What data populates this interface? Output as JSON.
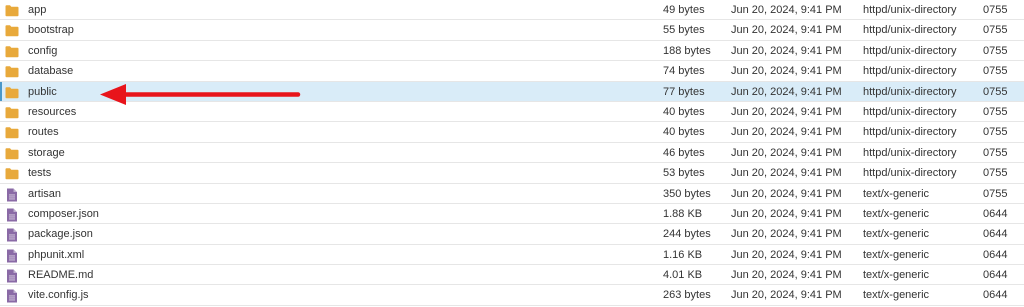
{
  "colors": {
    "folder": "#e8a93b",
    "document": "#8a6aa6",
    "selected_row": "#d9ecf8",
    "arrow": "#e8141b"
  },
  "files": [
    {
      "name": "app",
      "size": "49 bytes",
      "modified": "Jun 20, 2024, 9:41 PM",
      "type": "httpd/unix-directory",
      "permissions": "0755",
      "icon": "folder-icon"
    },
    {
      "name": "bootstrap",
      "size": "55 bytes",
      "modified": "Jun 20, 2024, 9:41 PM",
      "type": "httpd/unix-directory",
      "permissions": "0755",
      "icon": "folder-icon"
    },
    {
      "name": "config",
      "size": "188 bytes",
      "modified": "Jun 20, 2024, 9:41 PM",
      "type": "httpd/unix-directory",
      "permissions": "0755",
      "icon": "folder-icon"
    },
    {
      "name": "database",
      "size": "74 bytes",
      "modified": "Jun 20, 2024, 9:41 PM",
      "type": "httpd/unix-directory",
      "permissions": "0755",
      "icon": "folder-icon"
    },
    {
      "name": "public",
      "size": "77 bytes",
      "modified": "Jun 20, 2024, 9:41 PM",
      "type": "httpd/unix-directory",
      "permissions": "0755",
      "icon": "folder-icon",
      "selected": true
    },
    {
      "name": "resources",
      "size": "40 bytes",
      "modified": "Jun 20, 2024, 9:41 PM",
      "type": "httpd/unix-directory",
      "permissions": "0755",
      "icon": "folder-icon"
    },
    {
      "name": "routes",
      "size": "40 bytes",
      "modified": "Jun 20, 2024, 9:41 PM",
      "type": "httpd/unix-directory",
      "permissions": "0755",
      "icon": "folder-icon"
    },
    {
      "name": "storage",
      "size": "46 bytes",
      "modified": "Jun 20, 2024, 9:41 PM",
      "type": "httpd/unix-directory",
      "permissions": "0755",
      "icon": "folder-icon"
    },
    {
      "name": "tests",
      "size": "53 bytes",
      "modified": "Jun 20, 2024, 9:41 PM",
      "type": "httpd/unix-directory",
      "permissions": "0755",
      "icon": "folder-icon"
    },
    {
      "name": "artisan",
      "size": "350 bytes",
      "modified": "Jun 20, 2024, 9:41 PM",
      "type": "text/x-generic",
      "permissions": "0755",
      "icon": "document-icon"
    },
    {
      "name": "composer.json",
      "size": "1.88 KB",
      "modified": "Jun 20, 2024, 9:41 PM",
      "type": "text/x-generic",
      "permissions": "0644",
      "icon": "document-icon"
    },
    {
      "name": "package.json",
      "size": "244 bytes",
      "modified": "Jun 20, 2024, 9:41 PM",
      "type": "text/x-generic",
      "permissions": "0644",
      "icon": "document-icon"
    },
    {
      "name": "phpunit.xml",
      "size": "1.16 KB",
      "modified": "Jun 20, 2024, 9:41 PM",
      "type": "text/x-generic",
      "permissions": "0644",
      "icon": "document-icon"
    },
    {
      "name": "README.md",
      "size": "4.01 KB",
      "modified": "Jun 20, 2024, 9:41 PM",
      "type": "text/x-generic",
      "permissions": "0644",
      "icon": "document-icon"
    },
    {
      "name": "vite.config.js",
      "size": "263 bytes",
      "modified": "Jun 20, 2024, 9:41 PM",
      "type": "text/x-generic",
      "permissions": "0644",
      "icon": "document-icon"
    }
  ],
  "annotation": {
    "icon": "red-arrow-icon",
    "points_to": "public"
  }
}
